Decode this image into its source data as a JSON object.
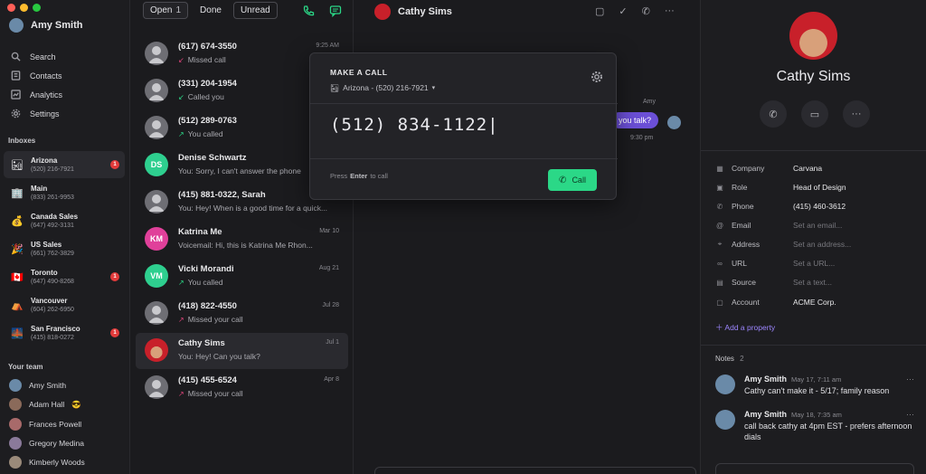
{
  "user": {
    "name": "Amy Smith"
  },
  "nav": [
    {
      "label": "Search",
      "icon": "search-icon"
    },
    {
      "label": "Contacts",
      "icon": "contacts-icon"
    },
    {
      "label": "Analytics",
      "icon": "analytics-icon"
    },
    {
      "label": "Settings",
      "icon": "gear-icon"
    }
  ],
  "inboxes_heading": "Inboxes",
  "inboxes": [
    {
      "name": "Arizona",
      "phone": "(520) 216-7921",
      "emoji": "🏜",
      "badge": "1"
    },
    {
      "name": "Main",
      "phone": "(833) 261-9953",
      "emoji": "🏢",
      "badge": ""
    },
    {
      "name": "Canada Sales",
      "phone": "(647) 492-3131",
      "emoji": "💰",
      "badge": ""
    },
    {
      "name": "US Sales",
      "phone": "(661) 762-3829",
      "emoji": "🎉",
      "badge": ""
    },
    {
      "name": "Toronto",
      "phone": "(647) 490-8268",
      "emoji": "🇨🇦",
      "badge": "1"
    },
    {
      "name": "Vancouver",
      "phone": "(604) 262-6950",
      "emoji": "⛺",
      "badge": ""
    },
    {
      "name": "San Francisco",
      "phone": "(415) 818-0272",
      "emoji": "🌉",
      "badge": "1"
    }
  ],
  "team_heading": "Your team",
  "team": [
    {
      "name": "Amy Smith",
      "emoji": ""
    },
    {
      "name": "Adam Hall",
      "emoji": "😎"
    },
    {
      "name": "Frances Powell",
      "emoji": ""
    },
    {
      "name": "Gregory Medina",
      "emoji": ""
    },
    {
      "name": "Kimberly Woods",
      "emoji": ""
    }
  ],
  "tabs": {
    "open": "Open",
    "open_count": "1",
    "done": "Done",
    "unread": "Unread"
  },
  "conversations": [
    {
      "name": "(617) 674-3550",
      "sub": "Missed call",
      "time": "9:25 AM",
      "arrow": "↙",
      "arrow_color": "#e0457b",
      "initials": "",
      "color": "#6e6e74"
    },
    {
      "name": "(331) 204-1954",
      "sub": "Called you",
      "time": "",
      "arrow": "↙",
      "arrow_color": "#2bd887",
      "initials": "",
      "color": "#6e6e74"
    },
    {
      "name": "(512) 289-0763",
      "sub": "You called",
      "time": "",
      "arrow": "↗",
      "arrow_color": "#2bd887",
      "initials": "",
      "color": "#6e6e74"
    },
    {
      "name": "Denise Schwartz",
      "sub": "You: Sorry, I can't answer the phone",
      "time": "",
      "arrow": "",
      "arrow_color": "",
      "initials": "DS",
      "color": "#2ecf8f"
    },
    {
      "name": "(415) 881-0322, Sarah",
      "sub": "You: Hey! When is a good time for a quick...",
      "time": "",
      "arrow": "",
      "arrow_color": "",
      "initials": "",
      "color": "#6e6e74"
    },
    {
      "name": "Katrina Me",
      "sub": "Voicemail: Hi, this is Katrina Me Rhon...",
      "time": "Mar 10",
      "arrow": "",
      "arrow_color": "",
      "initials": "KM",
      "color": "#e0409a"
    },
    {
      "name": "Vicki Morandi",
      "sub": "You called",
      "time": "Aug 21",
      "arrow": "↗",
      "arrow_color": "#2bd887",
      "initials": "VM",
      "color": "#2ecf8f"
    },
    {
      "name": "(418) 822-4550",
      "sub": "Missed your call",
      "time": "Jul 28",
      "arrow": "↗",
      "arrow_color": "#e0457b",
      "initials": "",
      "color": "#6e6e74"
    },
    {
      "name": "Cathy Sims",
      "sub": "You: Hey! Can you talk?",
      "time": "Jul 1",
      "arrow": "",
      "arrow_color": "",
      "initials": "",
      "color": "#c8202a"
    },
    {
      "name": "(415) 455-6524",
      "sub": "Missed your call",
      "time": "Apr 8",
      "arrow": "↗",
      "arrow_color": "#e0457b",
      "initials": "",
      "color": "#6e6e74"
    }
  ],
  "chat": {
    "contact": "Cathy Sims",
    "sender": "Amy",
    "message": "you talk?",
    "time": "9:30 pm"
  },
  "modal": {
    "title": "MAKE A CALL",
    "from": "Arizona - (520) 216-7921",
    "number": "(512) 834-1122",
    "hint_press": "Press",
    "hint_key": "Enter",
    "hint_rest": "to call",
    "call_label": "Call"
  },
  "contact": {
    "name": "Cathy Sims",
    "properties": [
      {
        "key": "Company",
        "value": "Carvana",
        "placeholder": false,
        "icon": "company-icon",
        "glyph": "▦"
      },
      {
        "key": "Role",
        "value": "Head of Design",
        "placeholder": false,
        "icon": "role-icon",
        "glyph": "▣"
      },
      {
        "key": "Phone",
        "value": "(415) 460-3612",
        "placeholder": false,
        "icon": "phone-icon",
        "glyph": "✆"
      },
      {
        "key": "Email",
        "value": "Set an email...",
        "placeholder": true,
        "icon": "email-icon",
        "glyph": "@"
      },
      {
        "key": "Address",
        "value": "Set an address...",
        "placeholder": true,
        "icon": "location-icon",
        "glyph": "⌖"
      },
      {
        "key": "URL",
        "value": "Set a URL...",
        "placeholder": true,
        "icon": "link-icon",
        "glyph": "∞"
      },
      {
        "key": "Source",
        "value": "Set a text...",
        "placeholder": true,
        "icon": "source-icon",
        "glyph": "▤"
      },
      {
        "key": "Account",
        "value": "ACME Corp.",
        "placeholder": false,
        "icon": "account-icon",
        "glyph": "▢"
      }
    ],
    "add_property": "Add a property",
    "notes_label": "Notes",
    "notes_count": "2",
    "notes": [
      {
        "author": "Amy Smith",
        "date": "May 17, 7:11 am",
        "text": "Cathy can't make it - 5/17; family reason"
      },
      {
        "author": "Amy Smith",
        "date": "May 18, 7:35 am",
        "text": "call back cathy at 4pm EST - prefers afternoon dials"
      }
    ]
  },
  "colors": {
    "accent": "#2bd887",
    "purple": "#6b4fd6",
    "badge": "#e23b3b"
  }
}
